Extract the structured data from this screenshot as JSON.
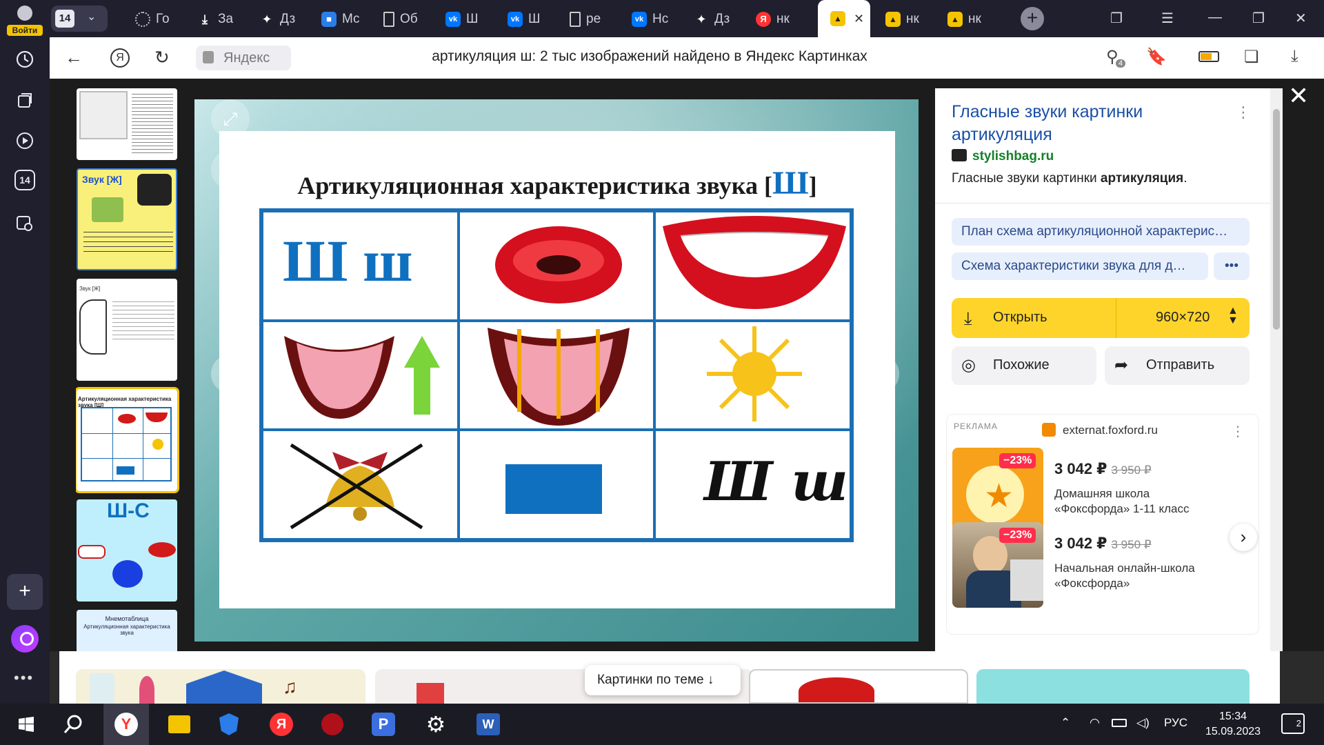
{
  "sidebar": {
    "login_label": "Войти",
    "tabs_count": "14"
  },
  "tabs": {
    "count": "14",
    "items": [
      {
        "label": "Го",
        "icon": "loading-icon"
      },
      {
        "label": "За",
        "icon": "download-icon"
      },
      {
        "label": "Дз",
        "icon": "sparkle-icon"
      },
      {
        "label": "Мс",
        "icon": "chat-icon"
      },
      {
        "label": "Об",
        "icon": "document-icon"
      },
      {
        "label": "Ш",
        "icon": "vk-icon"
      },
      {
        "label": "Ш",
        "icon": "vk-icon"
      },
      {
        "label": "ре",
        "icon": "document-icon"
      },
      {
        "label": "Нс",
        "icon": "vk-icon"
      },
      {
        "label": "Дз",
        "icon": "sparkle-icon"
      },
      {
        "label": "нк",
        "icon": "yandex-icon"
      }
    ],
    "active": {
      "icon": "images-icon"
    },
    "after": [
      {
        "label": "нк"
      },
      {
        "label": "нк"
      }
    ]
  },
  "address": {
    "host": "Яндекс",
    "title": "артикуляция ш: 2 тыс изображений найдено в Яндекс Картинках",
    "ext_badge": "4"
  },
  "slide": {
    "title": "Артикуляционная характеристика звука [",
    "title_letter": "Ш",
    "title_end": "]",
    "cell_letters": "Ш ш",
    "cell_script": "Ш ш"
  },
  "info": {
    "title": "Гласные звуки картинки артикуляция",
    "site": "stylishbag.ru",
    "desc_prefix": "Гласные звуки картинки ",
    "desc_bold": "артикуляция",
    "desc_end": ".",
    "tags": [
      "План схема артикуляционной характерис…",
      "Схема характеристики звука для д…"
    ],
    "more": "•••",
    "open_label": "Открыть",
    "size": "960×720",
    "similar_label": "Похожие",
    "share_label": "Отправить"
  },
  "ad": {
    "label": "РЕКЛАМА",
    "domain": "externat.foxford.ru",
    "items": [
      {
        "discount": "−23%",
        "price": "3 042 ₽",
        "old_price": "3 950 ₽",
        "name": "Домашняя школа «Фоксфорда» 1-11 класс"
      },
      {
        "discount": "−23%",
        "price": "3 042 ₽",
        "old_price": "3 950 ₽",
        "name": "Начальная онлайн-школа «Фоксфорда»"
      }
    ]
  },
  "strip": {
    "theme_label": "Картинки по теме"
  },
  "thumbs": {
    "t2_title": "Звук [Ж]",
    "t3_title": "Звук [Ж]",
    "t5_title": "Ш-С",
    "t6_title": "Мнемотаблица",
    "t6_sub": "Артикуляционная характеристика звука"
  },
  "taskbar": {
    "lang": "РУС",
    "time": "15:34",
    "date": "15.09.2023",
    "notif_count": "2"
  }
}
